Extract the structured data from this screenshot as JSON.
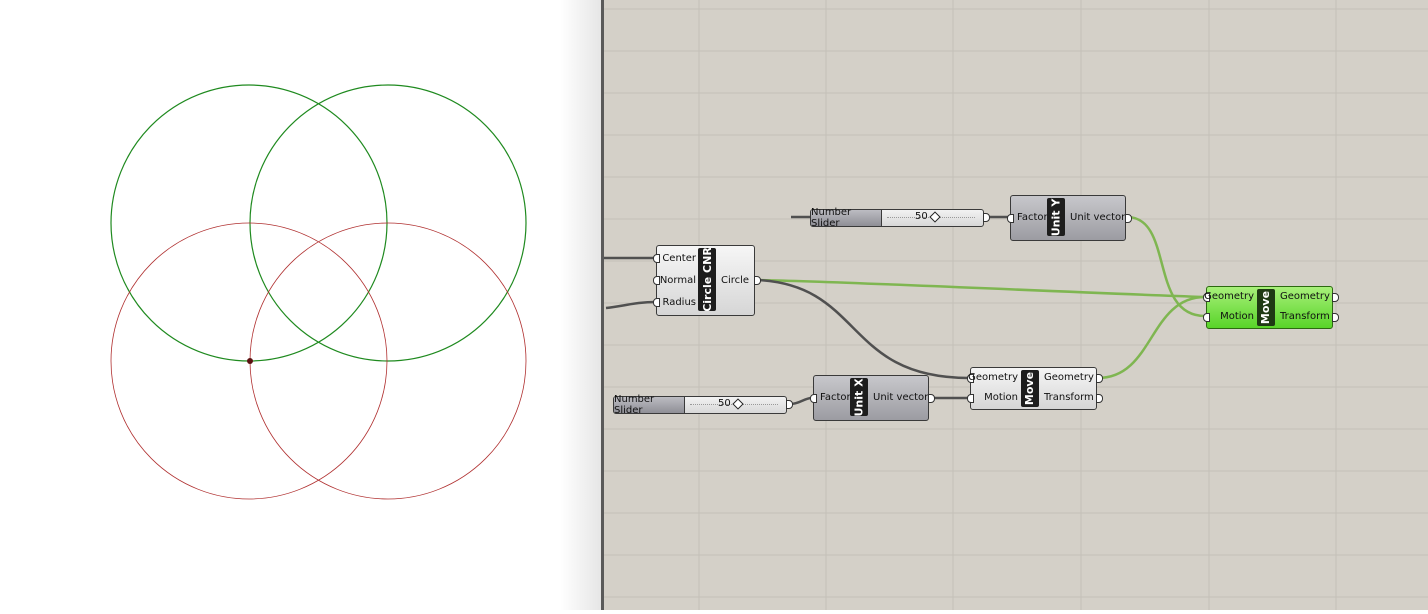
{
  "colors": {
    "canvas_background": "#d4d0c8",
    "wire_default": "#505050",
    "wire_selected": "#7fb651",
    "circle_selected": "#1f8a1f",
    "circle_preview": "#b03030",
    "component_selected": "#6de03a"
  },
  "viewport": {
    "circles_green": [
      {
        "label": "circle-green-1"
      },
      {
        "label": "circle-green-2"
      }
    ],
    "circles_red": [
      {
        "label": "circle-red-1"
      },
      {
        "label": "circle-red-2"
      }
    ]
  },
  "components": {
    "circle_cnr": {
      "nickname": "Circle CNR",
      "inputs": [
        "Center",
        "Normal",
        "Radius"
      ],
      "outputs": [
        "Circle"
      ]
    },
    "unit_y": {
      "nickname": "Unit Y",
      "inputs": [
        "Factor"
      ],
      "outputs": [
        "Unit vector"
      ]
    },
    "unit_x": {
      "nickname": "Unit X",
      "inputs": [
        "Factor"
      ],
      "outputs": [
        "Unit vector"
      ]
    },
    "move_1": {
      "nickname": "Move",
      "inputs": [
        "Geometry",
        "Motion"
      ],
      "outputs": [
        "Geometry",
        "Transform"
      ]
    },
    "move_2": {
      "nickname": "Move",
      "inputs": [
        "Geometry",
        "Motion"
      ],
      "outputs": [
        "Geometry",
        "Transform"
      ]
    }
  },
  "sliders": {
    "slider_top": {
      "name": "Number Slider",
      "value": "50",
      "level": 0.5
    },
    "slider_bottom": {
      "name": "Number Slider",
      "value": "50",
      "level": 0.5
    }
  }
}
